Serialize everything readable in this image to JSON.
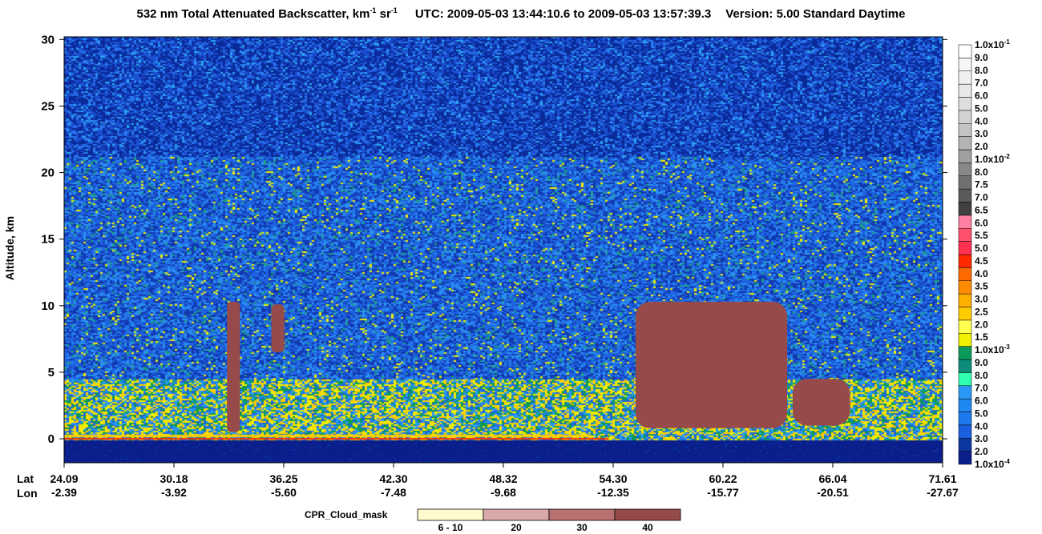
{
  "title": {
    "product": "532 nm Total Attenuated Backscatter, km",
    "unit_exp1": "-1",
    "unit_mid": " sr",
    "unit_exp2": "-1",
    "utc": "UTC:  2009-05-03 13:44:10.6  to  2009-05-03 13:57:39.3",
    "version": "Version: 5.00  Standard  Daytime"
  },
  "chart_data": {
    "type": "heatmap",
    "ylabel": "Altitude, km",
    "ylim": [
      -1.8,
      30.2
    ],
    "yticks": [
      "30",
      "25",
      "20",
      "15",
      "10",
      "5",
      "0"
    ],
    "x_row_labels": [
      "Lat",
      "Lon"
    ],
    "x_ticks": [
      {
        "lat": "24.09",
        "lon": "-2.39"
      },
      {
        "lat": "30.18",
        "lon": "-3.92"
      },
      {
        "lat": "36.25",
        "lon": "-5.60"
      },
      {
        "lat": "42.30",
        "lon": "-7.48"
      },
      {
        "lat": "48.32",
        "lon": "-9.68"
      },
      {
        "lat": "54.30",
        "lon": "-12.35"
      },
      {
        "lat": "60.22",
        "lon": "-15.77"
      },
      {
        "lat": "66.04",
        "lon": "-20.51"
      },
      {
        "lat": "71.61",
        "lon": "-27.67"
      }
    ],
    "colorbar": {
      "colors": [
        "#0a1e8c",
        "#0d37a0",
        "#1a5fe0",
        "#1e78ee",
        "#2088f2",
        "#2a98f5",
        "#30ffb0",
        "#0c8c7a",
        "#0b9a5a",
        "#f0f000",
        "#ffff50",
        "#ffcc00",
        "#ffb000",
        "#ff8c00",
        "#ff6a00",
        "#ff2a00",
        "#ff3050",
        "#ff5070",
        "#ff80a0",
        "#404040",
        "#5a5a5a",
        "#707070",
        "#888888",
        "#a0a0a0",
        "#b4b4b4",
        "#c4c4c4",
        "#d2d2d2",
        "#dedede",
        "#e8e8e8",
        "#f0f0f0",
        "#f6f6f6",
        "#ffffff"
      ],
      "labels": [
        {
          "base": "1.0x10",
          "exp": "-4"
        },
        {
          "base": "2.0"
        },
        {
          "base": "3.0"
        },
        {
          "base": "4.0"
        },
        {
          "base": "5.0"
        },
        {
          "base": "6.0"
        },
        {
          "base": "7.0"
        },
        {
          "base": "8.0"
        },
        {
          "base": "9.0"
        },
        {
          "base": "1.0x10",
          "exp": "-3"
        },
        {
          "base": "1.5"
        },
        {
          "base": "2.0"
        },
        {
          "base": "2.5"
        },
        {
          "base": "3.0"
        },
        {
          "base": "3.5"
        },
        {
          "base": "4.0"
        },
        {
          "base": "4.5"
        },
        {
          "base": "5.0"
        },
        {
          "base": "5.5"
        },
        {
          "base": "6.0"
        },
        {
          "base": "6.5"
        },
        {
          "base": "7.0"
        },
        {
          "base": "7.5"
        },
        {
          "base": "8.0"
        },
        {
          "base": "1.0x10",
          "exp": "-2"
        },
        {
          "base": "2.0"
        },
        {
          "base": "3.0"
        },
        {
          "base": "4.0"
        },
        {
          "base": "5.0"
        },
        {
          "base": "6.0"
        },
        {
          "base": "7.0"
        },
        {
          "base": "8.0"
        },
        {
          "base": "9.0"
        },
        {
          "base": "1.0x10",
          "exp": "-1"
        }
      ]
    },
    "cpr_cloud_mask": {
      "title": "CPR_Cloud_mask",
      "categories": [
        "6 - 10",
        "20",
        "30",
        "40"
      ],
      "colors": [
        "#fffacd",
        "#d9a8a8",
        "#b87070",
        "#964a4a"
      ]
    },
    "features": {
      "surface_altitude_km": 0.2,
      "cloud_mask_regions": [
        {
          "lat_range": [
            32.9,
            33.6
          ],
          "alt_range_km": [
            0.5,
            10.3
          ]
        },
        {
          "lat_range": [
            35.3,
            36.0
          ],
          "alt_range_km": [
            6.5,
            10.1
          ]
        },
        {
          "lat_range": [
            55.0,
            63.2
          ],
          "alt_range_km": [
            0.8,
            10.3
          ]
        },
        {
          "lat_range": [
            63.5,
            66.6
          ],
          "alt_range_km": [
            1.0,
            4.5
          ]
        }
      ]
    }
  }
}
